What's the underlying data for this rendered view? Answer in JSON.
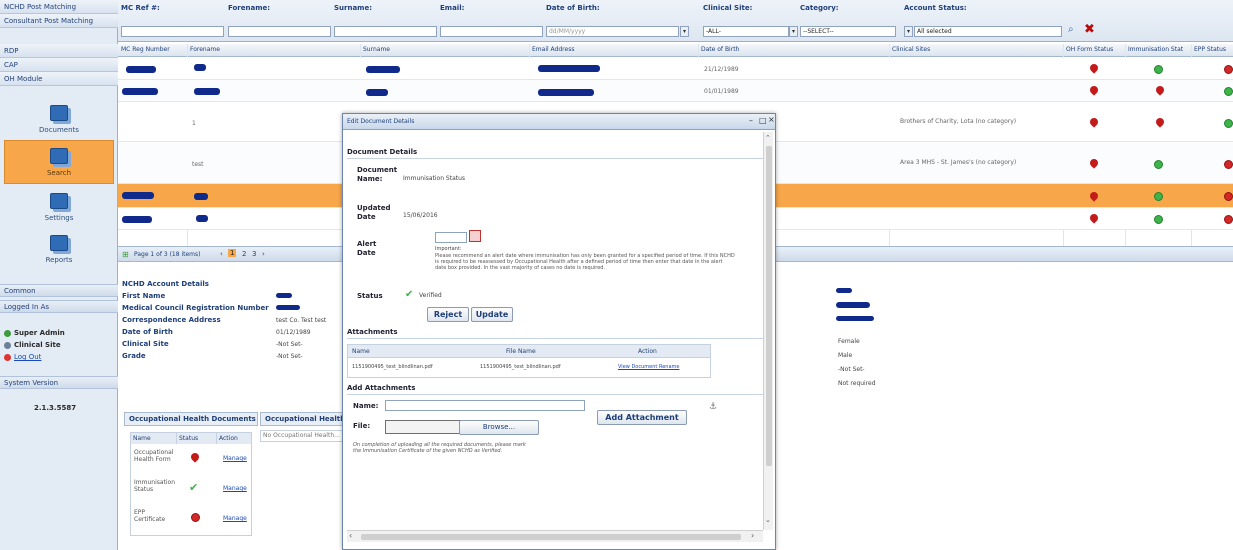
{
  "sidebar": {
    "links": [
      "NCHD Post Matching",
      "Consultant Post Matching",
      "RDP",
      "CAP",
      "OH Module"
    ],
    "tiles": [
      "Documents",
      "Search",
      "Settings",
      "Reports"
    ],
    "active_tile": "Search",
    "common_label": "Common",
    "logged_in_label": "Logged In As",
    "user_role": "Super Admin",
    "user_site": "Clinical Site",
    "logout_label": "Log Out",
    "version_label": "System Version",
    "version_value": "2.1.3.5587"
  },
  "search": {
    "labels": {
      "mc_ref": "MC Ref #:",
      "forename": "Forename:",
      "surname": "Surname:",
      "email": "Email:",
      "dob": "Date of Birth:",
      "clinical_site": "Clinical Site:",
      "category": "Category:",
      "account_status": "Account Status:"
    },
    "dob_placeholder": "dd/MM/yyyy",
    "clinical_site_value": "-ALL-",
    "category_value": "--SELECT--",
    "account_status_value": "All selected"
  },
  "grid": {
    "headers": [
      "MC Reg Number",
      "Forename",
      "Surname",
      "Email Address",
      "Date of Birth",
      "Clinical Sites",
      "OH Form Status",
      "Immunisation Stat",
      "EPP Status"
    ],
    "rows": [
      {
        "dob": "21/12/1989",
        "site": ""
      },
      {
        "dob": "01/01/1989",
        "site": ""
      },
      {
        "forename": "1",
        "site": "Brothers of Charity, Lota (no category)"
      },
      {
        "forename": "test",
        "site": "Area 3 MHS - St. James's (no category)"
      },
      {
        "site": ""
      },
      {
        "site": ""
      }
    ],
    "pager_text": "Page 1 of 3 (18 items)",
    "pages": [
      "1",
      "2",
      "3"
    ]
  },
  "detail": {
    "title": "NCHD Account Details",
    "labels": [
      "First Name",
      "Medical Council Registration Number",
      "Correspondence Address",
      "Date of Birth",
      "Clinical Site",
      "Grade"
    ],
    "values": [
      "",
      "",
      "test Co. Test test",
      "01/12/1989",
      "-Not Set-",
      "-Not Set-"
    ],
    "right_values": [
      "Female",
      "Male",
      "-Not Set-",
      "Not required"
    ]
  },
  "oh": {
    "tab1": "Occupational Health Documents",
    "tab2": "Occupational Health",
    "tab2_text": "No Occupational Health...",
    "headers": [
      "Name",
      "Status",
      "Action"
    ],
    "rows": [
      {
        "name": "Occupational Health Form",
        "action": "Manage"
      },
      {
        "name": "Immunisation Status",
        "action": "Manage"
      },
      {
        "name": "EPP Certificate",
        "action": "Manage"
      }
    ]
  },
  "modal": {
    "title": "Edit Document Details",
    "section": "Document Details",
    "doc_name_label": "Document Name:",
    "doc_name_value": "Immunisation Status",
    "updated_label": "Updated Date",
    "updated_value": "15/06/2016",
    "alert_label": "Alert Date",
    "alert_note": "Important:",
    "alert_help": "Please recommend an alert date where immunisation has only been granted for a specified period of time. If this NCHD is required to be reassessed by Occupational Health after a defined period of time then enter that date in the alert date box provided. In the vast majority of cases no date is required.",
    "status_label": "Status",
    "status_value": "Verified",
    "reject_label": "Reject",
    "update_label": "Update",
    "attachments_label": "Attachments",
    "att_headers": [
      "Name",
      "File Name",
      "Action"
    ],
    "att_row": {
      "name": "1151900495_test_blindlinan.pdf",
      "file": "1151900495_test_blindlinan.pdf",
      "action": "View Document Rename"
    },
    "add_att_label": "Add Attachments",
    "name_label": "Name:",
    "file_label": "File:",
    "browse_label": "Browse...",
    "add_button": "Add Attachment",
    "completion_note": "On completion of uploading all the required documents, please mark the Immunisation Certificate of the given NCHD as Verified."
  },
  "colors": {
    "accent": "#f7a649",
    "nav_blue": "#1f3f78",
    "redaction": "#0f2a8a",
    "status_red": "#c41a1a",
    "status_green": "#3db34a"
  }
}
